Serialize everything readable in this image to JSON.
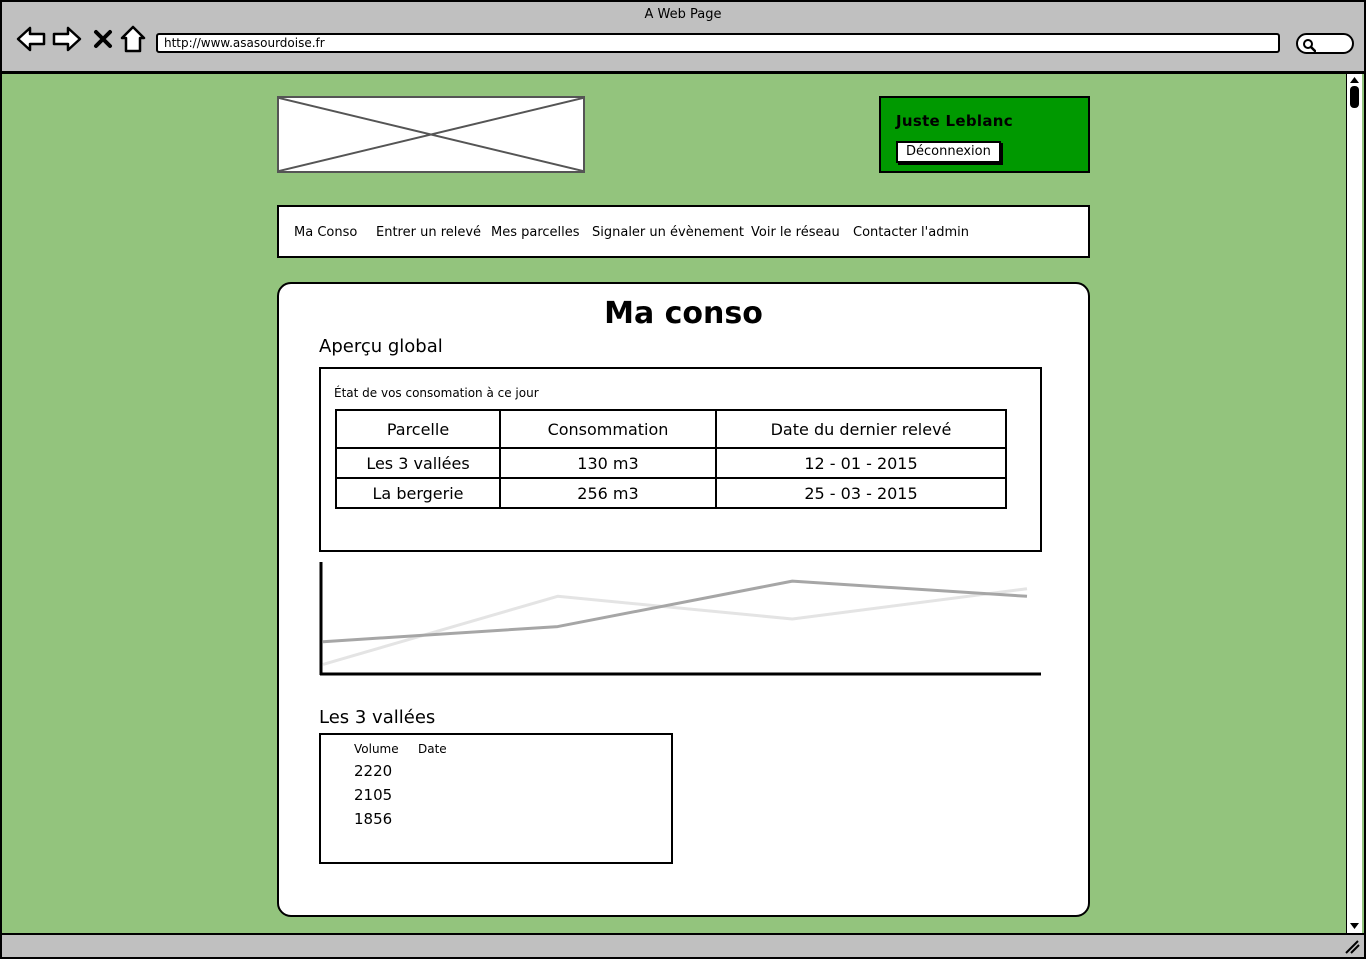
{
  "window": {
    "title": "A Web Page",
    "url": "http://www.asasourdoise.fr"
  },
  "colors": {
    "background": "#93c47d",
    "user_box": "#009900"
  },
  "header": {
    "user_name": "Juste Leblanc",
    "logout_label": "Déconnexion"
  },
  "nav": {
    "items": [
      {
        "label": "Ma Conso"
      },
      {
        "label": "Entrer un relevé"
      },
      {
        "label": "Mes parcelles"
      },
      {
        "label": "Signaler un évènement"
      },
      {
        "label": "Voir le réseau"
      },
      {
        "label": "Contacter l'admin"
      }
    ]
  },
  "main": {
    "title": "Ma conso",
    "overview": {
      "heading": "Aperçu global",
      "caption": "État de vos consomation à ce jour",
      "columns": [
        "Parcelle",
        "Consommation",
        "Date du dernier relevé"
      ],
      "rows": [
        [
          "Les 3 vallées",
          "130 m3",
          "12 - 01 - 2015"
        ],
        [
          "La bergerie",
          "256 m3",
          "25 - 03 - 2015"
        ]
      ]
    },
    "detail": {
      "heading": "Les 3 vallées",
      "columns": [
        "Volume",
        "Date"
      ],
      "volumes": [
        "2220",
        "2105",
        "1856"
      ]
    }
  },
  "chart_data": {
    "type": "line",
    "x": [
      0,
      1,
      2,
      3
    ],
    "series": [
      {
        "values": [
          5,
          50,
          35,
          55
        ],
        "color": "#e4e4e4"
      },
      {
        "values": [
          20,
          30,
          60,
          50
        ],
        "color": "#a6a6a6"
      }
    ],
    "ylim": [
      0,
      70
    ],
    "grid": false
  }
}
